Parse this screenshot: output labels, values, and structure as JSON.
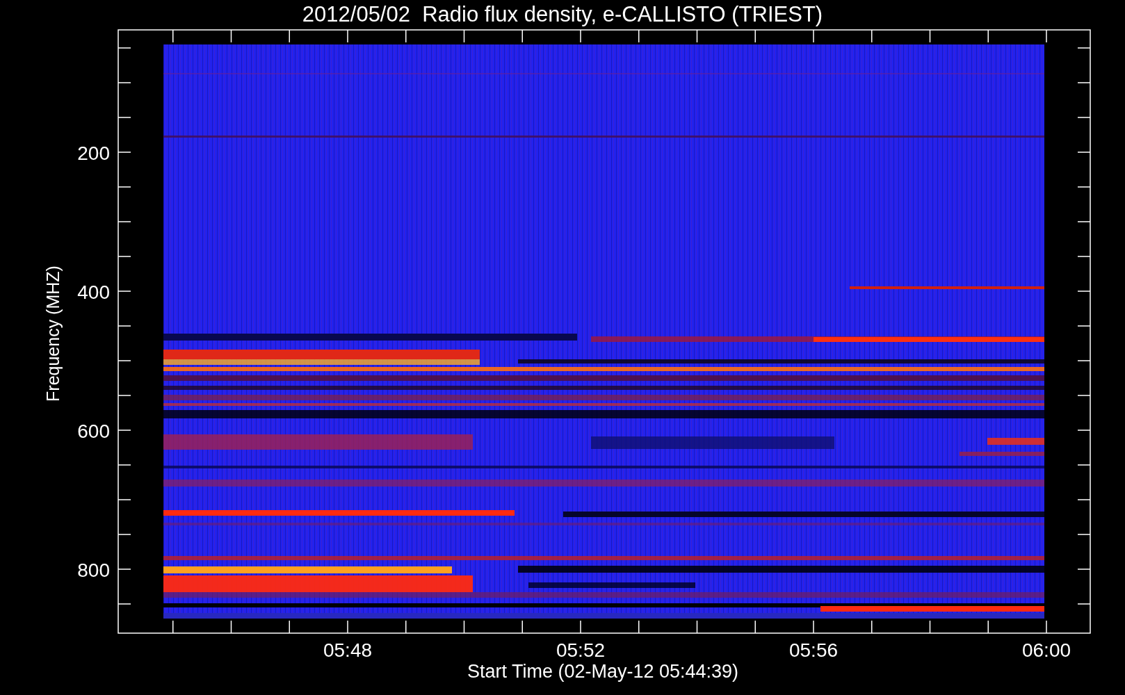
{
  "title": "2012/05/02  Radio flux density, e-CALLISTO (TRIEST)",
  "y_axis": {
    "label": "Frequency (MHZ)",
    "ticks": [
      "200",
      "400",
      "600",
      "800"
    ]
  },
  "x_axis": {
    "label": "Start Time (02-May-12 05:44:39)",
    "ticks": [
      "05:48",
      "05:52",
      "05:56",
      "06:00"
    ]
  }
}
